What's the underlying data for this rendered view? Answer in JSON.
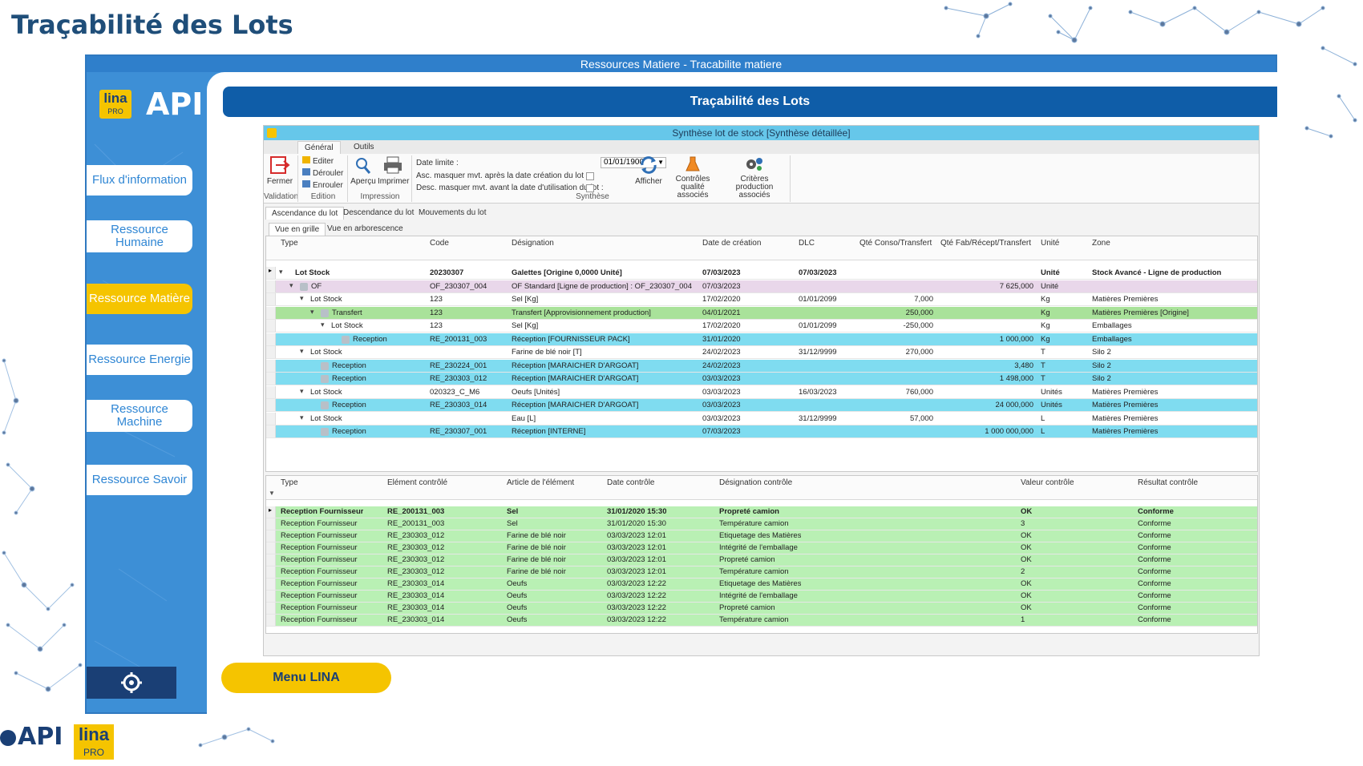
{
  "slide_title": "Traçabilité des Lots",
  "app": {
    "window_title": "Ressources Matiere - Tracabilite matiere",
    "brand": {
      "lina": "lina",
      "lina_sub": "PRO",
      "api": "API"
    },
    "sidebar": {
      "items": [
        {
          "label": "Flux d'information",
          "active": false
        },
        {
          "label": "Ressource Humaine",
          "active": false
        },
        {
          "label": "Ressource Matière",
          "active": true
        },
        {
          "label": "Ressource Energie",
          "active": false
        },
        {
          "label": "Ressource Machine",
          "active": false
        },
        {
          "label": "Ressource Savoir",
          "active": false
        }
      ],
      "settings_icon": "gear-icon"
    },
    "content_header": "Traçabilité des Lots",
    "menu_button": "Menu LINA"
  },
  "inner": {
    "title": "Synthèse lot de stock [Synthèse détaillée]",
    "ribbon_tabs": [
      "Général",
      "Outils"
    ],
    "ribbon": {
      "fermer": "Fermer",
      "validation": "Validation",
      "editer": "Editer",
      "derouler": "Dérouler",
      "enrouler": "Enrouler",
      "edition": "Edition",
      "apercu": "Aperçu",
      "imprimer": "Imprimer",
      "impression": "Impression",
      "date_limite_label": "Date limite :",
      "date_limite_value": "01/01/1900",
      "asc_label": "Asc. masquer mvt. après la date création du lot :",
      "desc_label": "Desc. masquer mvt. avant la date d'utilisation du lot :",
      "synthese": "Synthèse",
      "afficher": "Afficher",
      "controles": "Contrôles qualité associés",
      "criteres": "Critères production associés"
    },
    "tabs": [
      "Ascendance du lot",
      "Descendance du lot",
      "Mouvements du lot"
    ],
    "view_tabs": [
      "Vue en grille",
      "Vue en arborescence"
    ],
    "grid1": {
      "headers": [
        "Type",
        "Code",
        "Désignation",
        "Date de création",
        "DLC",
        "Qté Conso/Transfert",
        "Qté Fab/Récept/Transfert",
        "Unité",
        "Zone"
      ],
      "rows": [
        {
          "type": "Lot Stock",
          "code": "20230307",
          "designation": "Galettes [Origine 0,0000 Unité]",
          "date": "07/03/2023",
          "dlc": "07/03/2023",
          "conso": "",
          "fab": "",
          "unite": "Unité",
          "zone": "Stock Avancé - Ligne de production",
          "level": 0,
          "bold": true,
          "color": "#ffffff",
          "expand": "▾"
        },
        {
          "type": "OF",
          "code": "OF_230307_004",
          "designation": "OF Standard [Ligne de production] : OF_230307_004",
          "date": "07/03/2023",
          "dlc": "",
          "conso": "",
          "fab": "7 625,000",
          "unite": "Unité",
          "zone": "",
          "level": 1,
          "bold": false,
          "color": "#e9d7ea",
          "expand": "▾"
        },
        {
          "type": "Lot Stock",
          "code": "123",
          "designation": "Sel [Kg]",
          "date": "17/02/2020",
          "dlc": "01/01/2099",
          "conso": "7,000",
          "fab": "",
          "unite": "Kg",
          "zone": "Matières Premières",
          "level": 2,
          "bold": false,
          "color": "#ffffff",
          "expand": "▾"
        },
        {
          "type": "Transfert",
          "code": "123",
          "designation": "Transfert [Approvisionnement production]",
          "date": "04/01/2021",
          "dlc": "",
          "conso": "250,000",
          "fab": "",
          "unite": "Kg",
          "zone": "Matières Premières [Origine]",
          "level": 3,
          "bold": false,
          "color": "#a9e29a",
          "expand": "▾"
        },
        {
          "type": "Lot Stock",
          "code": "123",
          "designation": "Sel [Kg]",
          "date": "17/02/2020",
          "dlc": "01/01/2099",
          "conso": "-250,000",
          "fab": "",
          "unite": "Kg",
          "zone": "Emballages",
          "level": 4,
          "bold": false,
          "color": "#ffffff",
          "expand": "▾"
        },
        {
          "type": "Reception",
          "code": "RE_200131_003",
          "designation": "Réception [FOURNISSEUR PACK]",
          "date": "31/01/2020",
          "dlc": "",
          "conso": "",
          "fab": "1 000,000",
          "unite": "Kg",
          "zone": "Emballages",
          "level": 5,
          "bold": false,
          "color": "#7fdcf0",
          "expand": ""
        },
        {
          "type": "Lot Stock",
          "code": "",
          "designation": "Farine de blé noir [T]",
          "date": "24/02/2023",
          "dlc": "31/12/9999",
          "conso": "270,000",
          "fab": "",
          "unite": "T",
          "zone": "Silo 2",
          "level": 2,
          "bold": false,
          "color": "#ffffff",
          "expand": "▾"
        },
        {
          "type": "Reception",
          "code": "RE_230224_001",
          "designation": "Réception [MARAICHER D'ARGOAT]",
          "date": "24/02/2023",
          "dlc": "",
          "conso": "",
          "fab": "3,480",
          "unite": "T",
          "zone": "Silo 2",
          "level": 3,
          "bold": false,
          "color": "#7fdcf0",
          "expand": ""
        },
        {
          "type": "Reception",
          "code": "RE_230303_012",
          "designation": "Réception [MARAICHER D'ARGOAT]",
          "date": "03/03/2023",
          "dlc": "",
          "conso": "",
          "fab": "1 498,000",
          "unite": "T",
          "zone": "Silo 2",
          "level": 3,
          "bold": false,
          "color": "#7fdcf0",
          "expand": ""
        },
        {
          "type": "Lot Stock",
          "code": "020323_C_M6",
          "designation": "Oeufs [Unités]",
          "date": "03/03/2023",
          "dlc": "16/03/2023",
          "conso": "760,000",
          "fab": "",
          "unite": "Unités",
          "zone": "Matières Premières",
          "level": 2,
          "bold": false,
          "color": "#ffffff",
          "expand": "▾"
        },
        {
          "type": "Reception",
          "code": "RE_230303_014",
          "designation": "Réception [MARAICHER D'ARGOAT]",
          "date": "03/03/2023",
          "dlc": "",
          "conso": "",
          "fab": "24 000,000",
          "unite": "Unités",
          "zone": "Matières Premières",
          "level": 3,
          "bold": false,
          "color": "#7fdcf0",
          "expand": ""
        },
        {
          "type": "Lot Stock",
          "code": "",
          "designation": "Eau [L]",
          "date": "03/03/2023",
          "dlc": "31/12/9999",
          "conso": "57,000",
          "fab": "",
          "unite": "L",
          "zone": "Matières Premières",
          "level": 2,
          "bold": false,
          "color": "#ffffff",
          "expand": "▾"
        },
        {
          "type": "Reception",
          "code": "RE_230307_001",
          "designation": "Réception [INTERNE]",
          "date": "07/03/2023",
          "dlc": "",
          "conso": "",
          "fab": "1 000 000,000",
          "unite": "L",
          "zone": "Matières Premières",
          "level": 3,
          "bold": false,
          "color": "#7fdcf0",
          "expand": ""
        }
      ]
    },
    "grid2": {
      "headers": [
        "Type",
        "Elément contrôlé",
        "Article de l'élément",
        "Date contrôle",
        "Désignation contrôle",
        "Valeur contrôle",
        "Résultat contrôle"
      ],
      "rows": [
        [
          "Reception Fournisseur",
          "RE_200131_003",
          "Sel",
          "31/01/2020 15:30",
          "Propreté camion",
          "OK",
          "Conforme"
        ],
        [
          "Reception Fournisseur",
          "RE_200131_003",
          "Sel",
          "31/01/2020 15:30",
          "Température camion",
          "3",
          "Conforme"
        ],
        [
          "Reception Fournisseur",
          "RE_230303_012",
          "Farine de blé noir",
          "03/03/2023 12:01",
          "Etiquetage des Matières",
          "OK",
          "Conforme"
        ],
        [
          "Reception Fournisseur",
          "RE_230303_012",
          "Farine de blé noir",
          "03/03/2023 12:01",
          "Intégrité de l'emballage",
          "OK",
          "Conforme"
        ],
        [
          "Reception Fournisseur",
          "RE_230303_012",
          "Farine de blé noir",
          "03/03/2023 12:01",
          "Propreté camion",
          "OK",
          "Conforme"
        ],
        [
          "Reception Fournisseur",
          "RE_230303_012",
          "Farine de blé noir",
          "03/03/2023 12:01",
          "Température camion",
          "2",
          "Conforme"
        ],
        [
          "Reception Fournisseur",
          "RE_230303_014",
          "Oeufs",
          "03/03/2023 12:22",
          "Etiquetage des Matières",
          "OK",
          "Conforme"
        ],
        [
          "Reception Fournisseur",
          "RE_230303_014",
          "Oeufs",
          "03/03/2023 12:22",
          "Intégrité de l'emballage",
          "OK",
          "Conforme"
        ],
        [
          "Reception Fournisseur",
          "RE_230303_014",
          "Oeufs",
          "03/03/2023 12:22",
          "Propreté camion",
          "OK",
          "Conforme"
        ],
        [
          "Reception Fournisseur",
          "RE_230303_014",
          "Oeufs",
          "03/03/2023 12:22",
          "Température camion",
          "1",
          "Conforme"
        ]
      ],
      "row_color": "#b9f0b4"
    }
  },
  "bottom_logos": {
    "api": "API",
    "lina": "lina",
    "lina_sub": "PRO"
  }
}
